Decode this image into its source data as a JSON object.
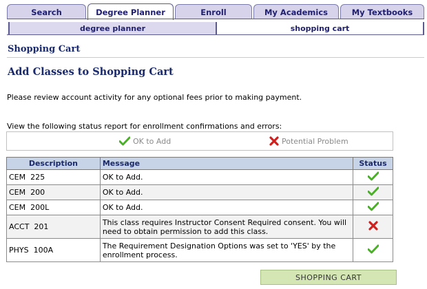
{
  "tabs": [
    {
      "label": "Search"
    },
    {
      "label": "Degree Planner"
    },
    {
      "label": "Enroll"
    },
    {
      "label": "My Academics"
    },
    {
      "label": "My Textbooks"
    }
  ],
  "subtabs": [
    {
      "label": "degree planner"
    },
    {
      "label": "shopping cart"
    }
  ],
  "page_title": "Shopping Cart",
  "section_title": "Add Classes to Shopping Cart",
  "info_text": "Please review account activity for any optional fees prior to making payment.",
  "status_intro": "View the following status report for enrollment confirmations and errors:",
  "legend": {
    "ok_label": "OK to Add",
    "problem_label": "Potential Problem"
  },
  "table": {
    "headers": {
      "description": "Description",
      "message": "Message",
      "status": "Status"
    },
    "rows": [
      {
        "description": "CEM  225",
        "message": "OK to Add.",
        "status": "ok"
      },
      {
        "description": "CEM  200",
        "message": "OK to Add.",
        "status": "ok"
      },
      {
        "description": "CEM  200L",
        "message": "OK to Add.",
        "status": "ok"
      },
      {
        "description": "ACCT  201",
        "message": "This class requires Instructor Consent Required consent. You will need to obtain permission to add this class.",
        "status": "problem"
      },
      {
        "description": "PHYS  100A",
        "message": "The Requirement Designation Options was set to 'YES' by the enrollment process.",
        "status": "ok"
      }
    ]
  },
  "button": {
    "label": "SHOPPING CART"
  },
  "colors": {
    "ok": "#4caf2a",
    "problem": "#d0201e",
    "header_bg": "#c7d3e6",
    "button_bg": "#d3e6b4"
  }
}
